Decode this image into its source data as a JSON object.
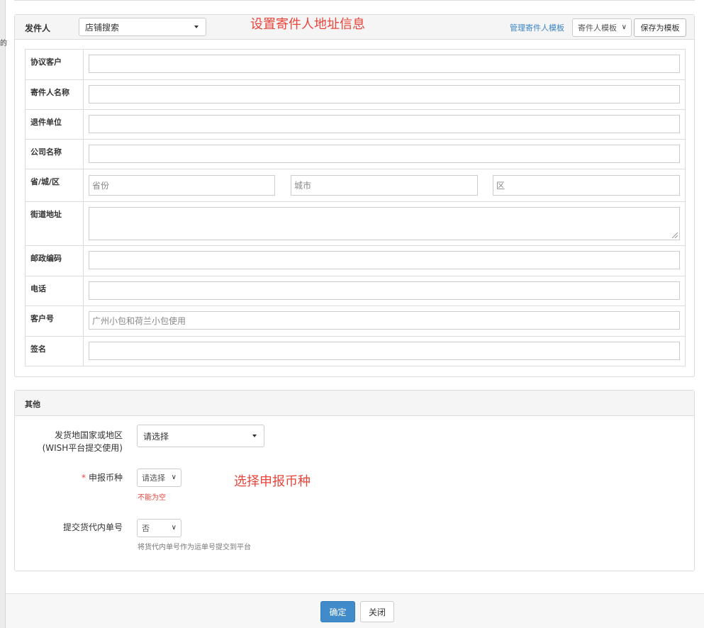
{
  "left_strip": {
    "cut_text": "的"
  },
  "sender_panel": {
    "title": "发件人",
    "shop_search": "店铺搜索",
    "annotation": "设置寄件人地址信息",
    "manage_template_link": "管理寄件人模板",
    "template_select": "寄件人模板",
    "save_template_button": "保存为模板",
    "rows": [
      {
        "label": "协议客户",
        "value": "",
        "placeholder": ""
      },
      {
        "label": "寄件人名称",
        "value": "",
        "placeholder": ""
      },
      {
        "label": "退件单位",
        "value": "",
        "placeholder": ""
      },
      {
        "label": "公司名称",
        "value": "",
        "placeholder": ""
      },
      {
        "label": "省/城/区",
        "province_placeholder": "省份",
        "city_placeholder": "城市",
        "district_placeholder": "区"
      },
      {
        "label": "街道地址",
        "value": "",
        "placeholder": ""
      },
      {
        "label": "邮政编码",
        "value": "",
        "placeholder": ""
      },
      {
        "label": "电话",
        "value": "",
        "placeholder": ""
      },
      {
        "label": "客户号",
        "value": "",
        "placeholder": "广州小包和荷兰小包使用"
      },
      {
        "label": "签名",
        "value": "",
        "placeholder": ""
      }
    ]
  },
  "other_panel": {
    "title": "其他",
    "country_label_line1": "发货地国家或地区",
    "country_label_line2": "(WISH平台提交使用)",
    "country_select": "请选择",
    "currency_label": "申报币种",
    "currency_required_mark": "*",
    "currency_select": "请选择",
    "currency_error": "不能为空",
    "annotation": "选择申报币种",
    "forwarder_label": "提交货代内单号",
    "forwarder_select": "否",
    "forwarder_hint": "将货代内单号作为运单号提交到平台"
  },
  "footer": {
    "confirm_button": "确定",
    "close_button": "关闭"
  },
  "colors": {
    "primary_button": "#428bca",
    "annotation_red": "#e8453c",
    "link_blue": "#3a84c4"
  }
}
